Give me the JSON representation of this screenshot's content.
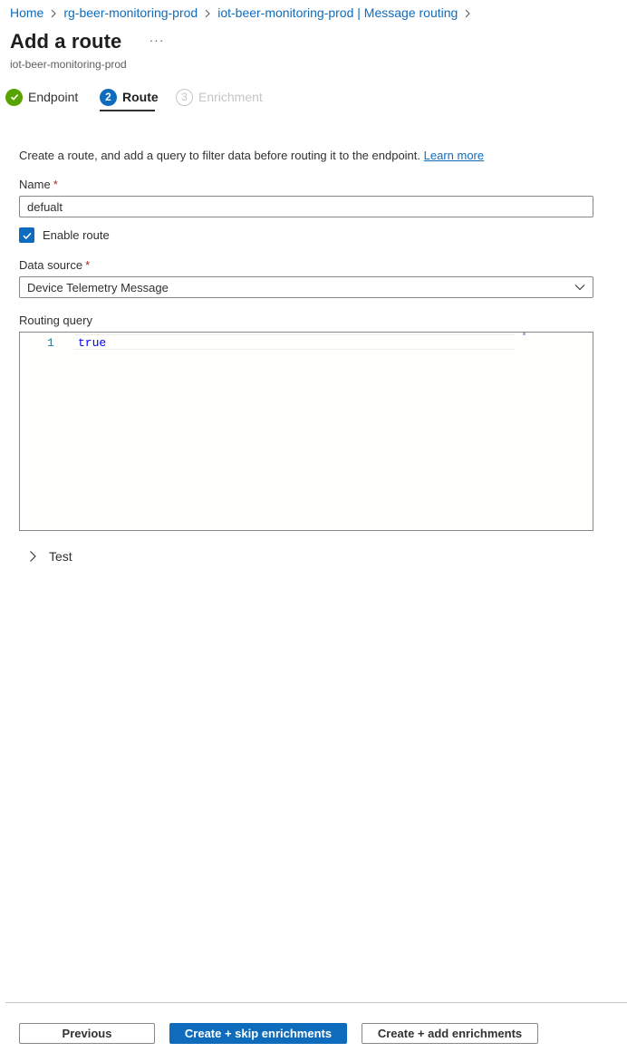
{
  "breadcrumb": {
    "items": [
      "Home",
      "rg-beer-monitoring-prod",
      "iot-beer-monitoring-prod | Message routing"
    ]
  },
  "page": {
    "title": "Add a route",
    "more_label": "···",
    "subtitle": "iot-beer-monitoring-prod"
  },
  "wizard": {
    "tabs": [
      {
        "step": "✓",
        "label": "Endpoint",
        "state": "completed"
      },
      {
        "step": "2",
        "label": "Route",
        "state": "active"
      },
      {
        "step": "3",
        "label": "Enrichment",
        "state": "disabled"
      }
    ]
  },
  "form": {
    "intro_text": "Create a route, and add a query to filter data before routing it to the endpoint.",
    "learn_more": "Learn more",
    "name_label": "Name",
    "name_value": "defualt",
    "required_marker": "*",
    "enable_route_label": "Enable route",
    "enable_route_checked": true,
    "data_source_label": "Data source",
    "data_source_value": "Device Telemetry Message",
    "routing_query_label": "Routing query",
    "query_line_number": "1",
    "query_code": "true",
    "test_label": "Test"
  },
  "footer": {
    "previous": "Previous",
    "create_skip": "Create + skip enrichments",
    "create_add": "Create + add enrichments"
  },
  "colors": {
    "accent": "#0f6cbd",
    "success": "#57a300",
    "required": "#a4262c"
  }
}
